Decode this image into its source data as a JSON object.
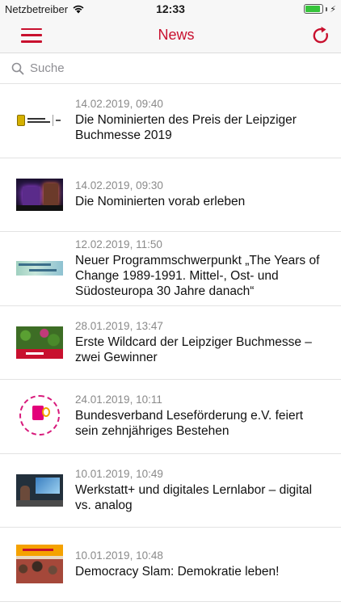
{
  "status_bar": {
    "carrier": "Netzbetreiber",
    "time": "12:33",
    "battery_level": 0.9
  },
  "nav": {
    "title": "News",
    "left_icon": "hamburger-menu-icon",
    "right_icon": "refresh-icon",
    "accent_color": "#c8102e"
  },
  "search": {
    "placeholder": "Suche",
    "value": ""
  },
  "news": [
    {
      "date": "14.02.2019, 09:40",
      "title": "Die Nominierten des Preis der Leipziger Buchmesse 2019",
      "thumb": "preis-logo"
    },
    {
      "date": "14.02.2019, 09:30",
      "title": "Die Nominierten vorab erleben",
      "thumb": "night-building"
    },
    {
      "date": "12.02.2019, 11:50",
      "title": "Neuer Programmschwerpunkt „The Years of Change 1989-1991. Mittel-, Ost- und Südosteuropa 30 Jahre danach“",
      "thumb": "years-of-change-banner"
    },
    {
      "date": "28.01.2019, 13:47",
      "title": "Erste Wildcard der Leipziger Buchmesse – zwei Gewinner",
      "thumb": "wildcard"
    },
    {
      "date": "24.01.2019, 10:11",
      "title": "Bundesverband Leseförderung e.V. feiert sein zehnjähriges Bestehen",
      "thumb": "verband-logo"
    },
    {
      "date": "10.01.2019, 10:49",
      "title": "Werkstatt+ und digitales Lernlabor – digital vs. analog",
      "thumb": "workshop"
    },
    {
      "date": "10.01.2019, 10:48",
      "title": "Democracy Slam: Demokratie leben!",
      "thumb": "democracy-slam"
    }
  ]
}
